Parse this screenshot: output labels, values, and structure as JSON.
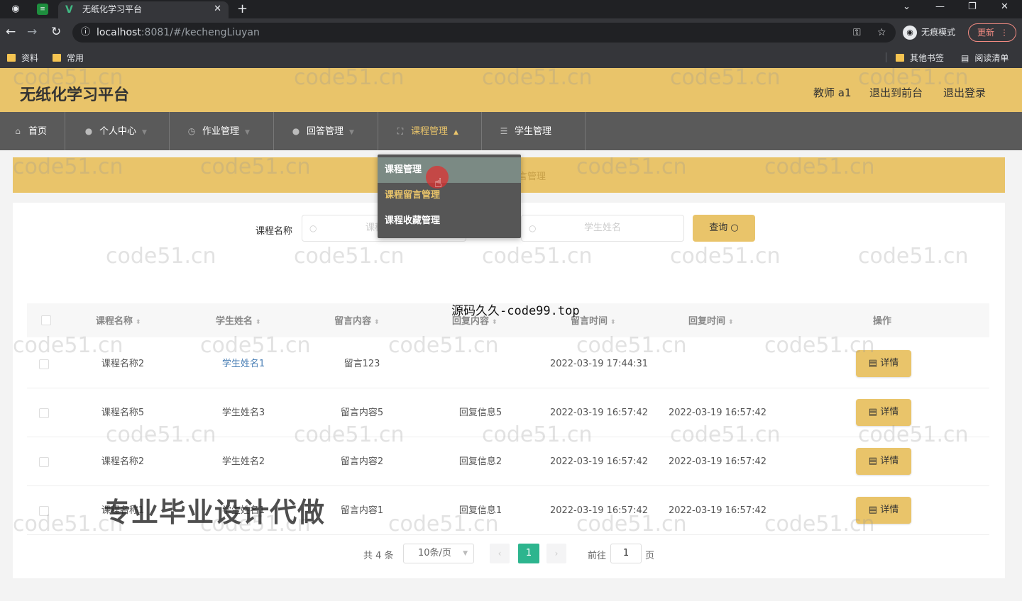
{
  "browser": {
    "tab_title": "无纸化学习平台",
    "url_host": "localhost",
    "url_path": ":8081/#/kechengLiuyan",
    "incognito_label": "无痕模式",
    "update_label": "更新",
    "bookmarks": [
      "资料",
      "常用"
    ],
    "bookmarks_right": [
      "其他书签",
      "阅读清单"
    ]
  },
  "header": {
    "title": "无纸化学习平台",
    "user": "教师 a1",
    "back_front": "退出到前台",
    "logout": "退出登录"
  },
  "nav": {
    "items": [
      {
        "label": "首页"
      },
      {
        "label": "个人中心"
      },
      {
        "label": "作业管理"
      },
      {
        "label": "回答管理"
      },
      {
        "label": "课程管理"
      },
      {
        "label": "学生管理"
      }
    ]
  },
  "dropdown": {
    "items": [
      "课程管理",
      "课程留言管理",
      "课程收藏管理"
    ]
  },
  "breadcrumb": {
    "text": "言管理"
  },
  "search": {
    "label": "课程名称",
    "course_placeholder": "课程名称",
    "student_placeholder": "学生姓名",
    "button": "查询"
  },
  "table": {
    "columns": [
      "课程名称",
      "学生姓名",
      "留言内容",
      "回复内容",
      "留言时间",
      "回复时间",
      "操作"
    ],
    "rows": [
      {
        "course": "课程名称2",
        "student": "学生姓名1",
        "message": "留言123",
        "reply": "",
        "msg_time": "2022-03-19 17:44:31",
        "reply_time": "",
        "action": "详情"
      },
      {
        "course": "课程名称5",
        "student": "学生姓名3",
        "message": "留言内容5",
        "reply": "回复信息5",
        "msg_time": "2022-03-19 16:57:42",
        "reply_time": "2022-03-19 16:57:42",
        "action": "详情"
      },
      {
        "course": "课程名称2",
        "student": "学生姓名2",
        "message": "留言内容2",
        "reply": "回复信息2",
        "msg_time": "2022-03-19 16:57:42",
        "reply_time": "2022-03-19 16:57:42",
        "action": "详情"
      },
      {
        "course": "课程名称1",
        "student": "学生姓名1",
        "message": "留言内容1",
        "reply": "回复信息1",
        "msg_time": "2022-03-19 16:57:42",
        "reply_time": "2022-03-19 16:57:42",
        "action": "详情"
      }
    ]
  },
  "pagination": {
    "total": "共 4 条",
    "page_size": "10条/页",
    "current": "1",
    "goto_label": "前往",
    "goto_value": "1",
    "page_suffix": "页"
  },
  "overlays": {
    "watermark": "code51.cn",
    "source_text": "源码久久-code99.top",
    "promo_text": "专业毕业设计代做"
  },
  "colors": {
    "accent": "#e9c46a",
    "nav_bg": "#5a5a5a",
    "pagination_active": "#2db58e"
  }
}
